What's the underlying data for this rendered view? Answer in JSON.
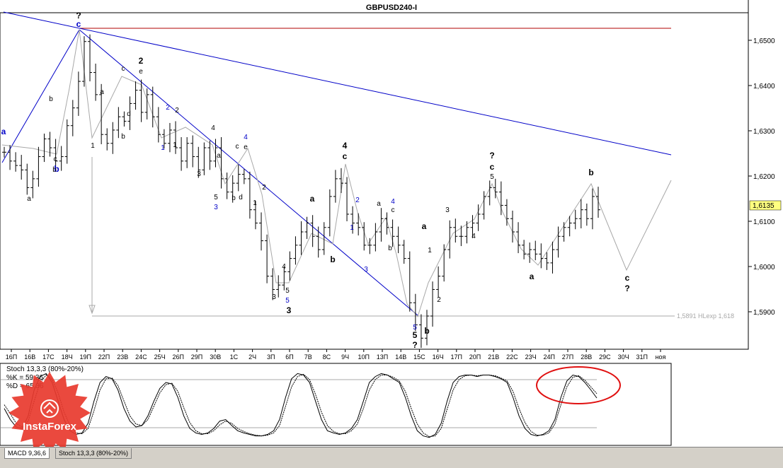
{
  "colors": {
    "background": "#ffffff",
    "bars": "#000000",
    "wave_blue": "#0000c8",
    "resistance_red": "#b00000",
    "projection_gray": "#a8a8a8",
    "circle_red": "#e01010",
    "price_tag_bg": "#ffff80"
  },
  "chart_data": [
    {
      "type": "ohlc",
      "title": "GBPUSD240-I",
      "y_ticks": [
        "1,6500",
        "1,6400",
        "1,6300",
        "1,6200",
        "1,6100",
        "1,6000",
        "1,5900"
      ],
      "ylim": [
        1.5825,
        1.6585
      ],
      "current_price": "1,6135",
      "x_ticks": [
        "16П",
        "16В",
        "17С",
        "18Ч",
        "19П",
        "22П",
        "23В",
        "24С",
        "25Ч",
        "26П",
        "29П",
        "30В",
        "1С",
        "2Ч",
        "3П",
        "6П",
        "7В",
        "8С",
        "9Ч",
        "10П",
        "13П",
        "14В",
        "15С",
        "16Ч",
        "17П",
        "20П",
        "21В",
        "22С",
        "23Ч",
        "24П",
        "27П",
        "28В",
        "29С",
        "30Ч",
        "31П",
        "ноя"
      ],
      "x_ticks_note": "labels as printed on the time axis (some partially overlapping)",
      "target_label": "1,5891 HLexp 1,618",
      "target_level": 1.5891,
      "close_series": [
        1.627,
        1.625,
        1.624,
        1.623,
        1.619,
        1.621,
        1.626,
        1.63,
        1.628,
        1.625,
        1.626,
        1.633,
        1.637,
        1.643,
        1.652,
        1.645,
        1.64,
        1.631,
        1.629,
        1.632,
        1.635,
        1.634,
        1.638,
        1.641,
        1.636,
        1.64,
        1.635,
        1.631,
        1.629,
        1.632,
        1.628,
        1.625,
        1.629,
        1.626,
        1.623,
        1.628,
        1.625,
        1.628,
        1.621,
        1.618,
        1.62,
        1.622,
        1.621,
        1.614,
        1.611,
        1.607,
        1.599,
        1.596,
        1.597,
        1.6,
        1.603,
        1.606,
        1.609,
        1.611,
        1.608,
        1.605,
        1.61,
        1.617,
        1.621,
        1.62,
        1.613,
        1.611,
        1.61,
        1.606,
        1.606,
        1.609,
        1.612,
        1.61,
        1.608,
        1.606,
        1.603,
        1.593,
        1.588,
        1.585,
        1.59,
        1.596,
        1.599,
        1.605,
        1.61,
        1.608,
        1.608,
        1.61,
        1.611,
        1.613,
        1.617,
        1.619,
        1.618,
        1.615,
        1.612,
        1.609,
        1.606,
        1.604,
        1.605,
        1.604,
        1.603,
        1.602,
        1.605,
        1.608,
        1.61,
        1.611,
        1.612,
        1.614,
        1.612,
        1.617,
        1.614
      ],
      "wave_labels": [
        {
          "text": "?",
          "color": "black",
          "bold": true
        },
        {
          "text": "c",
          "color": "blue",
          "bold": true
        },
        {
          "text": "2",
          "color": "black",
          "bold": true
        },
        {
          "text": "e",
          "color": "black",
          "bold": false
        },
        {
          "text": "c",
          "color": "black",
          "bold": false
        },
        {
          "text": "a",
          "color": "black",
          "bold": false
        },
        {
          "text": "b",
          "color": "black",
          "bold": false
        },
        {
          "text": "d",
          "color": "black",
          "bold": false
        },
        {
          "text": "b",
          "color": "black",
          "bold": false
        },
        {
          "text": "1",
          "color": "black",
          "bold": false
        },
        {
          "text": "a",
          "color": "blue",
          "bold": true
        },
        {
          "text": "b",
          "color": "blue",
          "bold": true
        },
        {
          "text": "c",
          "color": "black",
          "bold": false
        },
        {
          "text": "a",
          "color": "black",
          "bold": false
        },
        {
          "text": "b",
          "color": "black",
          "bold": false
        },
        {
          "text": "2",
          "color": "blue",
          "bold": false
        },
        {
          "text": "2",
          "color": "black",
          "bold": false
        },
        {
          "text": "1",
          "color": "blue",
          "bold": false
        },
        {
          "text": "1",
          "color": "black",
          "bold": false
        },
        {
          "text": "4",
          "color": "black",
          "bold": false
        },
        {
          "text": "4",
          "color": "blue",
          "bold": false
        },
        {
          "text": "c",
          "color": "black",
          "bold": false
        },
        {
          "text": "e",
          "color": "black",
          "bold": false
        },
        {
          "text": "a",
          "color": "black",
          "bold": false
        },
        {
          "text": "3",
          "color": "black",
          "bold": false
        },
        {
          "text": "5",
          "color": "black",
          "bold": false
        },
        {
          "text": "3",
          "color": "blue",
          "bold": false
        },
        {
          "text": "b",
          "color": "black",
          "bold": false
        },
        {
          "text": "d",
          "color": "black",
          "bold": false
        },
        {
          "text": "2",
          "color": "black",
          "bold": false
        },
        {
          "text": "1",
          "color": "black",
          "bold": false
        },
        {
          "text": "4",
          "color": "black",
          "bold": false
        },
        {
          "text": "5",
          "color": "black",
          "bold": false
        },
        {
          "text": "5",
          "color": "blue",
          "bold": false
        },
        {
          "text": "3",
          "color": "black",
          "bold": false
        },
        {
          "text": "3",
          "color": "black",
          "bold": true
        },
        {
          "text": "a",
          "color": "black",
          "bold": true
        },
        {
          "text": "b",
          "color": "black",
          "bold": true
        },
        {
          "text": "4",
          "color": "black",
          "bold": true
        },
        {
          "text": "c",
          "color": "black",
          "bold": true
        },
        {
          "text": "2",
          "color": "blue",
          "bold": false
        },
        {
          "text": "1",
          "color": "blue",
          "bold": false
        },
        {
          "text": "3",
          "color": "blue",
          "bold": false
        },
        {
          "text": "a",
          "color": "black",
          "bold": false
        },
        {
          "text": "4",
          "color": "blue",
          "bold": false
        },
        {
          "text": "c",
          "color": "black",
          "bold": false
        },
        {
          "text": "b",
          "color": "black",
          "bold": false
        },
        {
          "text": "a",
          "color": "black",
          "bold": true
        },
        {
          "text": "1",
          "color": "black",
          "bold": false
        },
        {
          "text": "3",
          "color": "black",
          "bold": false
        },
        {
          "text": "2",
          "color": "black",
          "bold": false
        },
        {
          "text": "4",
          "color": "black",
          "bold": false
        },
        {
          "text": "5",
          "color": "blue",
          "bold": false
        },
        {
          "text": "5",
          "color": "black",
          "bold": true
        },
        {
          "text": "?",
          "color": "black",
          "bold": true
        },
        {
          "text": "b",
          "color": "black",
          "bold": true
        },
        {
          "text": "?",
          "color": "black",
          "bold": true
        },
        {
          "text": "c",
          "color": "black",
          "bold": true
        },
        {
          "text": "5",
          "color": "black",
          "bold": false
        },
        {
          "text": "a",
          "color": "black",
          "bold": true
        },
        {
          "text": "b",
          "color": "black",
          "bold": true
        },
        {
          "text": "c",
          "color": "black",
          "bold": true
        },
        {
          "text": "?",
          "color": "black",
          "bold": true
        }
      ]
    },
    {
      "type": "line",
      "title": "Stoch 13,3,3 (80%-20%)",
      "k_label": "%K = 59,36",
      "d_label": "%D = 65,36",
      "levels": [
        80,
        20
      ],
      "k_series": [
        45,
        30,
        20,
        18,
        35,
        70,
        88,
        92,
        80,
        55,
        30,
        15,
        10,
        12,
        25,
        55,
        80,
        88,
        85,
        70,
        45,
        28,
        20,
        22,
        35,
        55,
        72,
        80,
        78,
        60,
        35,
        18,
        12,
        10,
        12,
        18,
        28,
        30,
        22,
        15,
        12,
        10,
        8,
        8,
        10,
        15,
        30,
        60,
        85,
        92,
        90,
        80,
        55,
        30,
        15,
        12,
        10,
        12,
        18,
        30,
        55,
        80,
        88,
        92,
        90,
        85,
        80,
        60,
        35,
        15,
        8,
        6,
        10,
        25,
        55,
        80,
        88,
        90,
        90,
        88,
        90,
        90,
        88,
        85,
        80,
        60,
        35,
        18,
        10,
        8,
        10,
        15,
        30,
        60,
        82,
        90,
        88,
        80,
        70,
        59
      ],
      "d_series": [
        50,
        38,
        25,
        20,
        28,
        55,
        80,
        90,
        84,
        66,
        40,
        22,
        12,
        11,
        18,
        42,
        70,
        85,
        86,
        76,
        55,
        35,
        24,
        22,
        30,
        48,
        66,
        77,
        79,
        68,
        46,
        26,
        15,
        11,
        11,
        15,
        23,
        28,
        25,
        18,
        14,
        11,
        9,
        8,
        9,
        12,
        22,
        48,
        74,
        88,
        91,
        84,
        64,
        40,
        22,
        14,
        11,
        11,
        15,
        24,
        45,
        70,
        84,
        90,
        90,
        87,
        82,
        68,
        45,
        24,
        12,
        7,
        8,
        18,
        44,
        70,
        84,
        89,
        90,
        89,
        90,
        90,
        89,
        86,
        82,
        68,
        45,
        26,
        14,
        9,
        9,
        12,
        24,
        50,
        74,
        87,
        89,
        83,
        74,
        65
      ]
    }
  ],
  "logo": {
    "name": "InstaForex",
    "icon": "instaforex-logo-icon"
  },
  "tabs": [
    {
      "label": "MACD 9,36,6",
      "active": true
    },
    {
      "label": "Stoch 13,3,3 (80%-20%)",
      "active": false
    }
  ]
}
